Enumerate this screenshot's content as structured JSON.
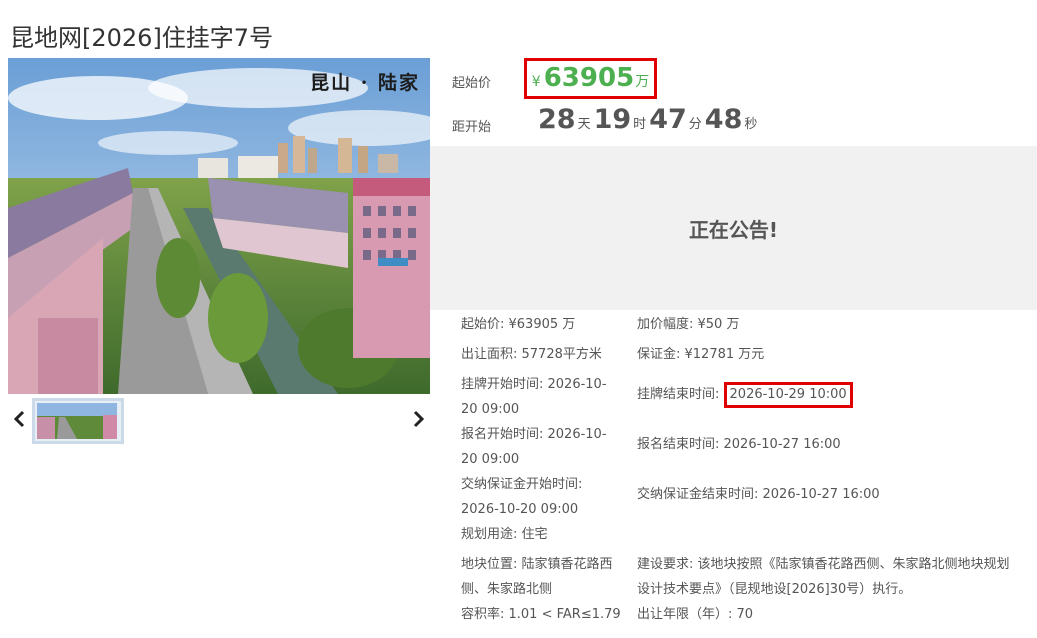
{
  "page_title": "昆地网[2026]住挂字7号",
  "photo": {
    "caption": "昆山 · 陆家"
  },
  "price": {
    "label": "起始价",
    "currency": "¥",
    "value": "63905",
    "unit": "万"
  },
  "countdown": {
    "label": "距开始",
    "days": "28",
    "days_unit": "天",
    "hours": "19",
    "hours_unit": "时",
    "minutes": "47",
    "minutes_unit": "分",
    "seconds": "48",
    "seconds_unit": "秒"
  },
  "status": "正在公告!",
  "details": {
    "start_price": "起始价:  ¥63905 万",
    "increment": "加价幅度:  ¥50 万",
    "area": "出让面积:   57728平方米",
    "deposit": "保证金:  ¥12781 万元",
    "listing_start_1": "挂牌开始时间:   2026-10-",
    "listing_start_2": "20 09:00",
    "listing_end_label": "挂牌结束时间:",
    "listing_end_value": "2026-10-29 10:00",
    "reg_start_1": "报名开始时间:   2026-10-",
    "reg_start_2": "20 09:00",
    "reg_end": "报名结束时间:   2026-10-27 16:00",
    "deposit_start_1": "交纳保证金开始时间:",
    "deposit_start_2": "2026-10-20 09:00",
    "deposit_end": "交纳保证金结束时间:   2026-10-27 16:00",
    "usage": "规划用途:   住宅",
    "location_1": "地块位置:   陆家镇香花路西",
    "location_2": "侧、朱家路北侧",
    "requirement_1": "建设要求:   该地块按照《陆家镇香花路西侧、朱家路北侧地块规划",
    "requirement_2": "设计技术要点》（昆规地设[2026]30号）执行。",
    "far": "容积率:   1.01 < FAR≤1.79",
    "term": "出让年限（年）:   70"
  },
  "colors": {
    "accent_green": "#4caf50",
    "highlight_red": "#e00000",
    "panel_gray": "#f1f1f1"
  }
}
